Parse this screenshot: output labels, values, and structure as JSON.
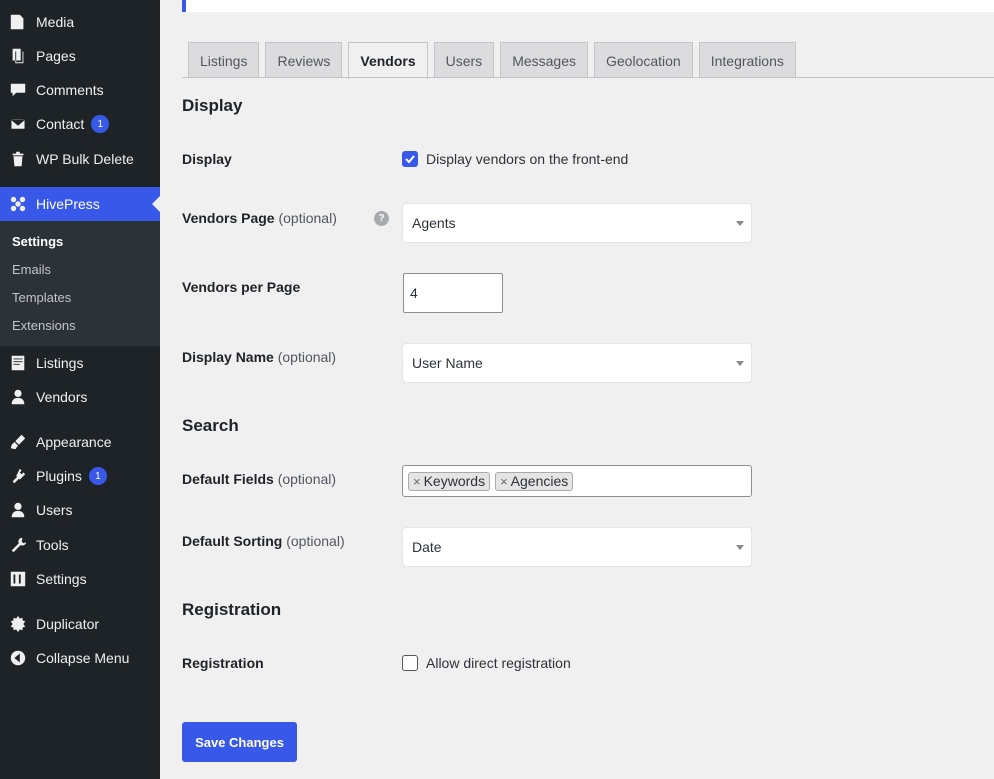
{
  "sidebar": {
    "items": [
      {
        "label": "Media",
        "icon": "media-icon"
      },
      {
        "label": "Pages",
        "icon": "pages-icon"
      },
      {
        "label": "Comments",
        "icon": "comments-icon"
      },
      {
        "label": "Contact",
        "icon": "mail-icon",
        "badge": "1"
      },
      {
        "label": "WP Bulk Delete",
        "icon": "trash-icon"
      },
      {
        "label": "HivePress",
        "icon": "hivepress-icon"
      },
      {
        "label": "Listings",
        "icon": "listings-icon"
      },
      {
        "label": "Vendors",
        "icon": "user-icon"
      },
      {
        "label": "Appearance",
        "icon": "brush-icon"
      },
      {
        "label": "Plugins",
        "icon": "plugin-icon",
        "badge": "1"
      },
      {
        "label": "Users",
        "icon": "user-icon"
      },
      {
        "label": "Tools",
        "icon": "wrench-icon"
      },
      {
        "label": "Settings",
        "icon": "sliders-icon"
      },
      {
        "label": "Duplicator",
        "icon": "duplicator-icon"
      },
      {
        "label": "Collapse Menu",
        "icon": "collapse-icon"
      }
    ],
    "submenu": [
      "Settings",
      "Emails",
      "Templates",
      "Extensions"
    ]
  },
  "tabs": [
    "Listings",
    "Reviews",
    "Vendors",
    "Users",
    "Messages",
    "Geolocation",
    "Integrations"
  ],
  "active_tab": "Vendors",
  "sections": {
    "display": "Display",
    "search": "Search",
    "registration": "Registration"
  },
  "fields": {
    "display": {
      "label": "Display",
      "checkbox_label": "Display vendors on the front-end",
      "checked": true
    },
    "vendors_page": {
      "label": "Vendors Page",
      "optional": "(optional)",
      "value": "Agents"
    },
    "per_page": {
      "label": "Vendors per Page",
      "value": "4"
    },
    "display_name": {
      "label": "Display Name",
      "optional": "(optional)",
      "value": "User Name"
    },
    "default_fields": {
      "label": "Default Fields",
      "optional": "(optional)",
      "chips": [
        "Keywords",
        "Agencies"
      ]
    },
    "default_sorting": {
      "label": "Default Sorting",
      "optional": "(optional)",
      "value": "Date"
    },
    "registration": {
      "label": "Registration",
      "checkbox_label": "Allow direct registration",
      "checked": false
    }
  },
  "help_glyph": "?",
  "chip_remove": "×",
  "save_label": "Save Changes",
  "colors": {
    "accent": "#3858e9",
    "sidebar": "#1d2327",
    "background": "#f0f0f1"
  }
}
